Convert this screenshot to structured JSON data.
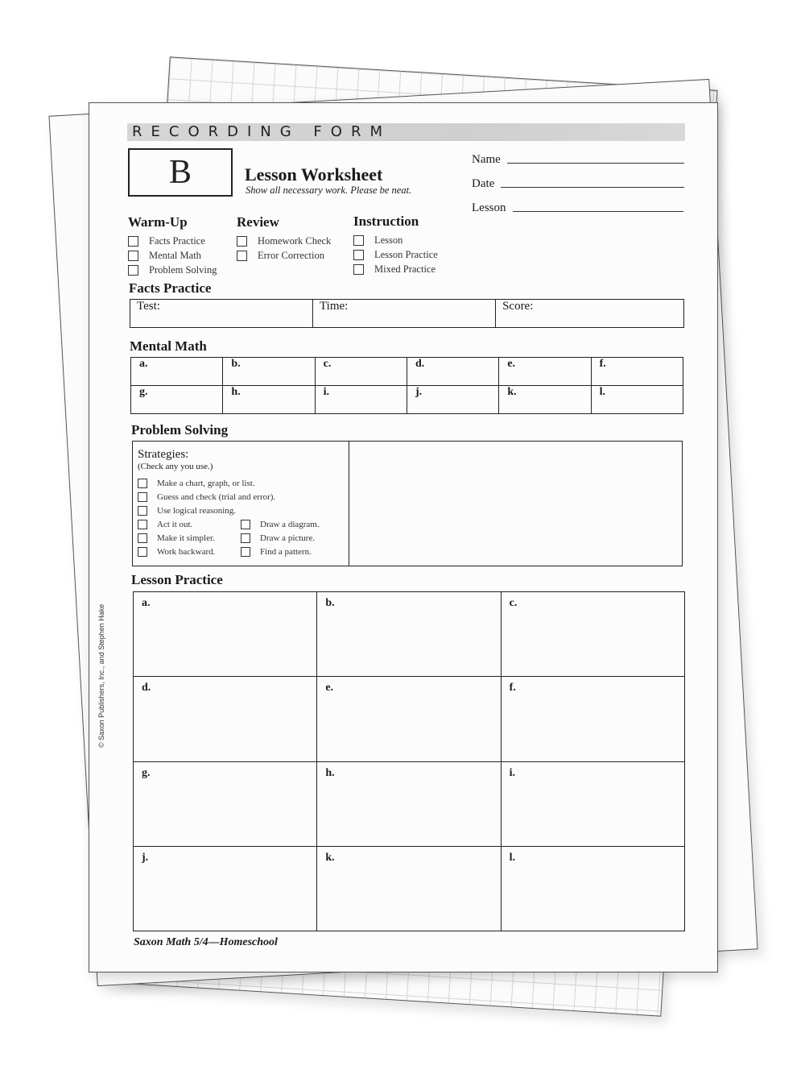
{
  "banner": "RECORDING FORM",
  "form_letter": "B",
  "title": "Lesson Worksheet",
  "subtitle": "Show all necessary work. Please be neat.",
  "fields": [
    {
      "label": "Name",
      "value": ""
    },
    {
      "label": "Date",
      "value": ""
    },
    {
      "label": "Lesson",
      "value": ""
    }
  ],
  "groups": [
    {
      "title": "Warm-Up",
      "items": [
        "Facts Practice",
        "Mental Math",
        "Problem Solving"
      ]
    },
    {
      "title": "Review",
      "items": [
        "Homework Check",
        "Error Correction"
      ]
    },
    {
      "title": "Instruction",
      "items": [
        "Lesson",
        "Lesson Practice",
        "Mixed Practice"
      ]
    }
  ],
  "facts_practice": {
    "title": "Facts Practice",
    "cells": [
      "Test:",
      "Time:",
      "Score:"
    ]
  },
  "mental_math": {
    "title": "Mental Math",
    "rows": [
      [
        "a.",
        "b.",
        "c.",
        "d.",
        "e.",
        "f."
      ],
      [
        "g.",
        "h.",
        "i.",
        "j.",
        "k.",
        "l."
      ]
    ]
  },
  "problem_solving": {
    "title": "Problem Solving",
    "strategies_label": "Strategies:",
    "hint": "(Check any you use.)",
    "full_items": [
      "Make a chart, graph, or list.",
      "Guess and check (trial and error).",
      "Use logical reasoning."
    ],
    "left_items": [
      "Act it out.",
      "Make it simpler.",
      "Work backward."
    ],
    "right_items": [
      "Draw a diagram.",
      "Draw a picture.",
      "Find a pattern."
    ]
  },
  "lesson_practice": {
    "title": "Lesson Practice",
    "rows": [
      [
        "a.",
        "b.",
        "c."
      ],
      [
        "d.",
        "e.",
        "f."
      ],
      [
        "g.",
        "h.",
        "i."
      ],
      [
        "j.",
        "k.",
        "l."
      ]
    ]
  },
  "copyright": "© Saxon Publishers, Inc., and Stephen Hake",
  "footer": "Saxon Math 5/4—Homeschool"
}
